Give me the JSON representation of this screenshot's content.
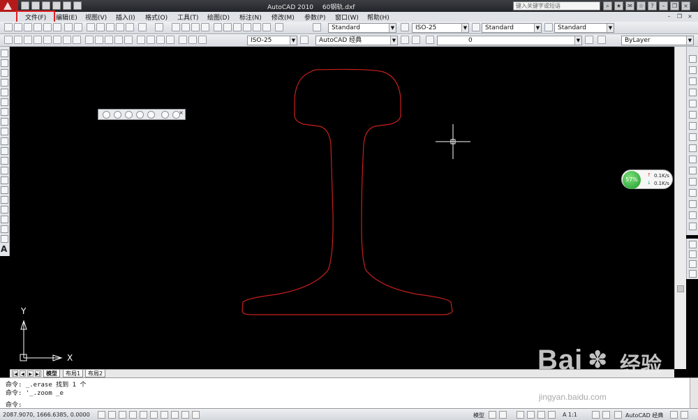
{
  "titlebar": {
    "app_name": "AutoCAD 2010",
    "document": "60钢轨.dxf",
    "search_placeholder": "键入关键字或短语"
  },
  "menu": {
    "items": [
      "文件(F)",
      "编辑(E)",
      "视图(V)",
      "插入(I)",
      "格式(O)",
      "工具(T)",
      "绘图(D)",
      "标注(N)",
      "修改(M)",
      "参数(P)",
      "窗口(W)",
      "帮助(H)"
    ],
    "highlighted_index": 0,
    "highlight_color": "#e02020"
  },
  "toolbar1": {
    "text_style": "Standard",
    "dim_style": "ISO-25",
    "table_style": "Standard",
    "multileader_style": "Standard"
  },
  "toolbar2": {
    "dim_style2": "ISO-25",
    "workspace": "AutoCAD 经典",
    "layer": "0",
    "color": "ByLayer"
  },
  "axis": {
    "y_label": "Y",
    "x_label": "X"
  },
  "drawing": {
    "stroke_color": "#c8201e",
    "crosshair_color": "#ffffff"
  },
  "net_widget": {
    "percent": "57%",
    "up_rate": "0.1K/s",
    "down_rate": "0.1K/s",
    "accent": "#2aa83a"
  },
  "tabs": [
    "模型",
    "布局1",
    "布局2"
  ],
  "command": {
    "lines": [
      "命令: _.erase 找到 1 个",
      "命令: '_.zoom _e"
    ],
    "prompt": "命令:"
  },
  "status": {
    "coords": "2087.9070, 1666.6385, 0.0000",
    "model_label": "模型",
    "scale": "1:1",
    "workspace": "AutoCAD 经典"
  },
  "watermark": {
    "text": "Bai",
    "cn": "经验",
    "url": "jingyan.baidu.com"
  }
}
